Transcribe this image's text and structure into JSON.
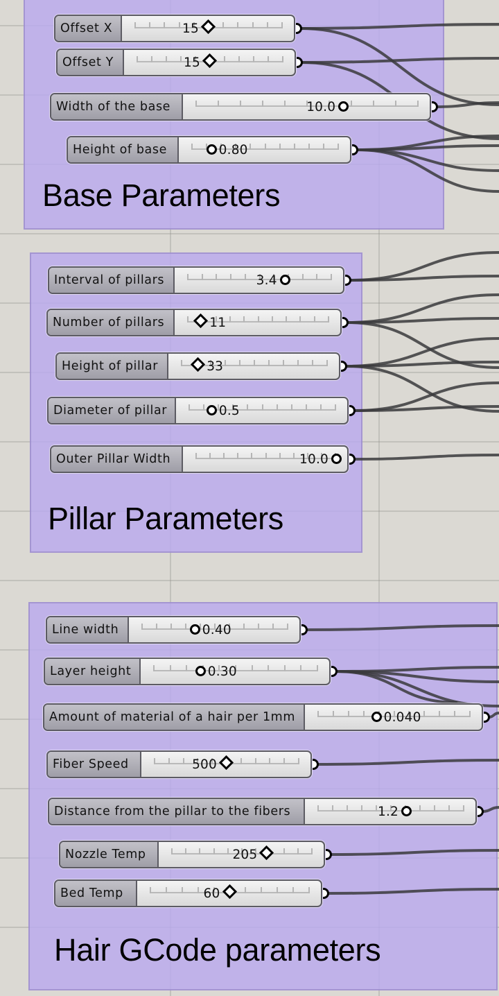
{
  "canvas": {
    "background": "#dbd9d3",
    "group_color": "#c3b6e9",
    "wire_color": "#3a3a3c"
  },
  "groups": [
    {
      "title": "Base Parameters",
      "sliders": [
        {
          "label": "Offset X",
          "value": "15",
          "handle": "diamond",
          "fraction": 0.5
        },
        {
          "label": "Offset Y",
          "value": "15",
          "handle": "diamond",
          "fraction": 0.5
        },
        {
          "label": "Width of the base",
          "value": "10.0",
          "handle": "circle",
          "fraction": 0.66
        },
        {
          "label": "Height of base",
          "value": "0.80",
          "handle": "circle",
          "fraction": 0.15
        }
      ]
    },
    {
      "title": "Pillar Parameters",
      "sliders": [
        {
          "label": "Interval of pillars",
          "value": "3.4",
          "handle": "circle",
          "fraction": 0.67
        },
        {
          "label": "Number of pillars",
          "value": "11",
          "handle": "diamond",
          "fraction": 0.1
        },
        {
          "label": "Height of pillar",
          "value": "33",
          "handle": "diamond",
          "fraction": 0.12
        },
        {
          "label": "Diameter of pillar",
          "value": "0.5",
          "handle": "circle",
          "fraction": 0.17
        },
        {
          "label": "Outer Pillar Width",
          "value": "10.0",
          "handle": "circle",
          "fraction": 1.0
        }
      ]
    },
    {
      "title": "Hair GCode parameters",
      "sliders": [
        {
          "label": "Line width",
          "value": "0.40",
          "handle": "circle",
          "fraction": 0.38
        },
        {
          "label": "Layer height",
          "value": "0.30",
          "handle": "circle",
          "fraction": 0.3
        },
        {
          "label": "Amount of material of a hair per 1mm",
          "value": "0.040",
          "handle": "circle",
          "fraction": 0.4
        },
        {
          "label": "Fiber Speed",
          "value": "500",
          "handle": "diamond",
          "fraction": 0.5
        },
        {
          "label": "Distance from the pillar to the fibers",
          "value": "1.2",
          "handle": "circle",
          "fraction": 0.6
        },
        {
          "label": "Nozzle Temp",
          "value": "205",
          "handle": "diamond",
          "fraction": 0.68
        },
        {
          "label": "Bed Temp",
          "value": "60",
          "handle": "diamond",
          "fraction": 0.5
        }
      ]
    }
  ]
}
